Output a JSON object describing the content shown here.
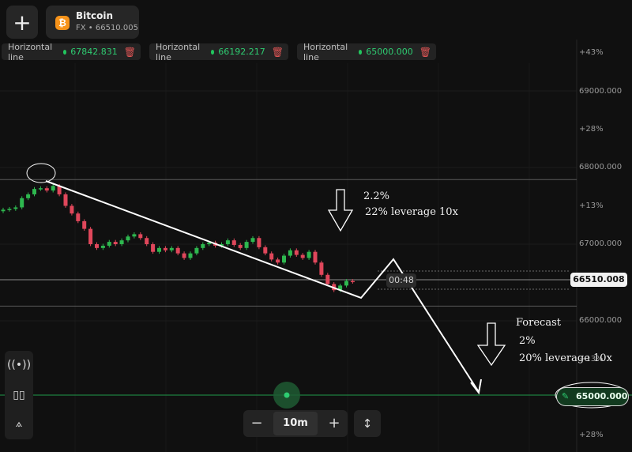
{
  "asset": {
    "add_label": "+",
    "icon_glyph": "₿",
    "name": "Bitcoin",
    "subtitle": "FX • 66510.005",
    "icon_color": "#f7931a"
  },
  "horizontal_lines": [
    {
      "label": "Horizontal line",
      "value": "67842.831"
    },
    {
      "label": "Horizontal line",
      "value": "66192.217"
    },
    {
      "label": "Horizontal line",
      "value": "65000.000"
    }
  ],
  "price_axis": {
    "labels": [
      "+43%",
      "69000.000",
      "+28%",
      "68000.000",
      "+13%",
      "67000.000",
      "66000.000",
      "+13%",
      "+28%"
    ]
  },
  "current_price": "66510.008",
  "timer": "00:48",
  "target_price": "65000.000",
  "zoom": {
    "minus": "−",
    "value": "10m",
    "plus": "+",
    "updown": "↕"
  },
  "side_tools": [
    "broadcast-icon",
    "candles-icon",
    "compass-icon"
  ],
  "annotations": {
    "first": [
      "2.2%",
      "22% leverage 10x"
    ],
    "second": [
      "Forecast",
      "2%",
      "20% leverage 10x"
    ]
  },
  "colors": {
    "up": "#2eb84f",
    "down": "#e0475b",
    "target_line": "#1f9a4a",
    "accent_green": "#22c55e"
  },
  "chart_data": {
    "type": "candlestick",
    "y_axis": {
      "min": 64500,
      "max": 69500,
      "ticks": [
        66000,
        67000,
        68000,
        69000
      ]
    },
    "horizontal_levels": [
      67842.831,
      66192.217,
      65000.0
    ],
    "current_price": 66510.008,
    "candles_close": [
      67450,
      67460,
      67480,
      67600,
      67650,
      67720,
      67730,
      67700,
      67760,
      67650,
      67500,
      67400,
      67300,
      67200,
      67000,
      66950,
      66980,
      67030,
      67000,
      67050,
      67100,
      67130,
      67080,
      67000,
      66900,
      66950,
      66920,
      66950,
      66880,
      66820,
      66880,
      66950,
      67000,
      67020,
      66980,
      67000,
      67050,
      66990,
      66950,
      67030,
      67080,
      66960,
      66880,
      66800,
      66760,
      66850,
      66920,
      66860,
      66820,
      66900,
      66760,
      66600,
      66480,
      66400,
      66460,
      66520,
      66510
    ]
  }
}
